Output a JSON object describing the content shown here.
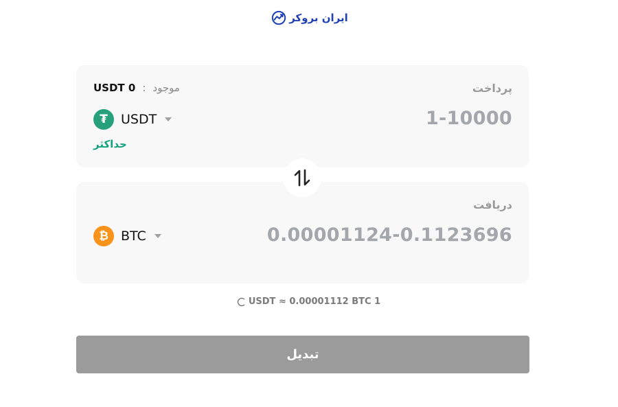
{
  "brand": {
    "logo_text": "ایران بروکر",
    "logo_icon": "chart-trend-icon",
    "color": "#1f3fb4"
  },
  "pay": {
    "label": "پرداخت",
    "amount_placeholder": "1-10000",
    "balance_label": "موجود",
    "balance_separator": ":",
    "balance_value": "USDT 0",
    "coin": {
      "symbol": "USDT",
      "icon": "tether-icon",
      "icon_glyph": "₮",
      "color": "#26a17b"
    },
    "max_label": "حداکثر"
  },
  "swap": {
    "icon": "swap-arrows-icon"
  },
  "receive": {
    "label": "دریافت",
    "amount_placeholder": "0.00001124-0.1123696",
    "coin": {
      "symbol": "BTC",
      "icon": "bitcoin-icon",
      "icon_glyph": "₿",
      "color": "#f7931a"
    }
  },
  "rate": {
    "text": "USDT ≈ 0.00001112 BTC 1"
  },
  "submit": {
    "label": "تبدیل"
  },
  "colors": {
    "panel_bg": "#f8f8f8",
    "accent_green": "#14a37f",
    "button_disabled": "#9b9b9b"
  }
}
